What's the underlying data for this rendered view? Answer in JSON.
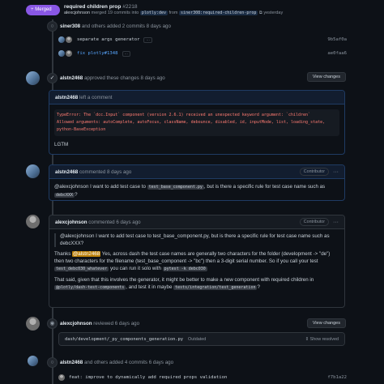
{
  "pr": {
    "state": "Merged",
    "title": "required children prop",
    "number": "#2218",
    "author": "alexcjohnson",
    "merged_text": "merged 19 commits into",
    "base_branch": "plotly:dev",
    "from_text": "from",
    "head_branch": "siner308:required-children-prop",
    "time": "yesterday"
  },
  "events": {
    "commits1": {
      "user": "siner308",
      "text": "and others added 2 commits 8 days ago",
      "items": [
        {
          "msg": "separate args generator",
          "sha": "9b5af0a"
        },
        {
          "msg": "fix plotly#1348",
          "sha": "ae0faa6"
        }
      ]
    },
    "approval": {
      "user": "alstn2468",
      "text": "approved these changes 8 days ago",
      "button": "View changes",
      "comment_user": "alstn2468",
      "comment_text": "left a comment",
      "error_lines": [
        "TypeError: The `dcc.Input` component (version 2.6.1) received an unexpected keyword argument: `children`",
        "Allowed arguments: autoComplete, autoFocus, className, debounce, disabled, id, inputMode, list, loading_state,",
        "python-BaseException"
      ],
      "body": "LGTM"
    },
    "comment1": {
      "user": "alstn2468",
      "text": "commented 8 days ago",
      "badge": "Contributor",
      "p1": "@alexcjohnson I want to add test case to",
      "code1": "test_base_component.py",
      "p2": ", but is there a specific rule for test case name such as",
      "code2": "debcXXX",
      "p3": "?"
    },
    "comment2": {
      "user": "alexcjohnson",
      "text": "commented 6 days ago",
      "badge": "Contributor",
      "quote": "@alexcjohnson I want to add test case to test_base_component.py, but is there a specific rule for test case name such as debcXXX?",
      "thanks": "Thanks",
      "mention": "@alstn2468",
      "para1a": "Yes, across dash the test case names are generally two characters for the folder (development ->",
      "para1b": "\"de\") then two characters for the filename (test_base_component -> \"bc\") then a 3-digit serial number. So if you call your",
      "para1c": "test",
      "code_a": "test_debc030_whatever",
      "para1d": "you can run it solo with",
      "code_b": "pytest -k debc030",
      "para2a": "That said, given that this involves the generator, it might be better to make a new component with required children in",
      "code_c": "@plotly/dash-test-components",
      "para2b": ", and test it in maybe",
      "code_d": "tests/integration/test_generation",
      "para2c": "?"
    },
    "review": {
      "user": "alexcjohnson",
      "text": "reviewed 6 days ago",
      "button": "View changes",
      "file": "dash/development/_py_components_generation.py",
      "status": "Outdated",
      "show_resolved": "Show resolved"
    },
    "commits2": {
      "user": "alstn2468",
      "text": "and others added 4 commits 6 days ago",
      "items": [
        {
          "msg": "feat: improve to dynamically add required props validation",
          "sha": "f7b1a22"
        }
      ]
    }
  }
}
